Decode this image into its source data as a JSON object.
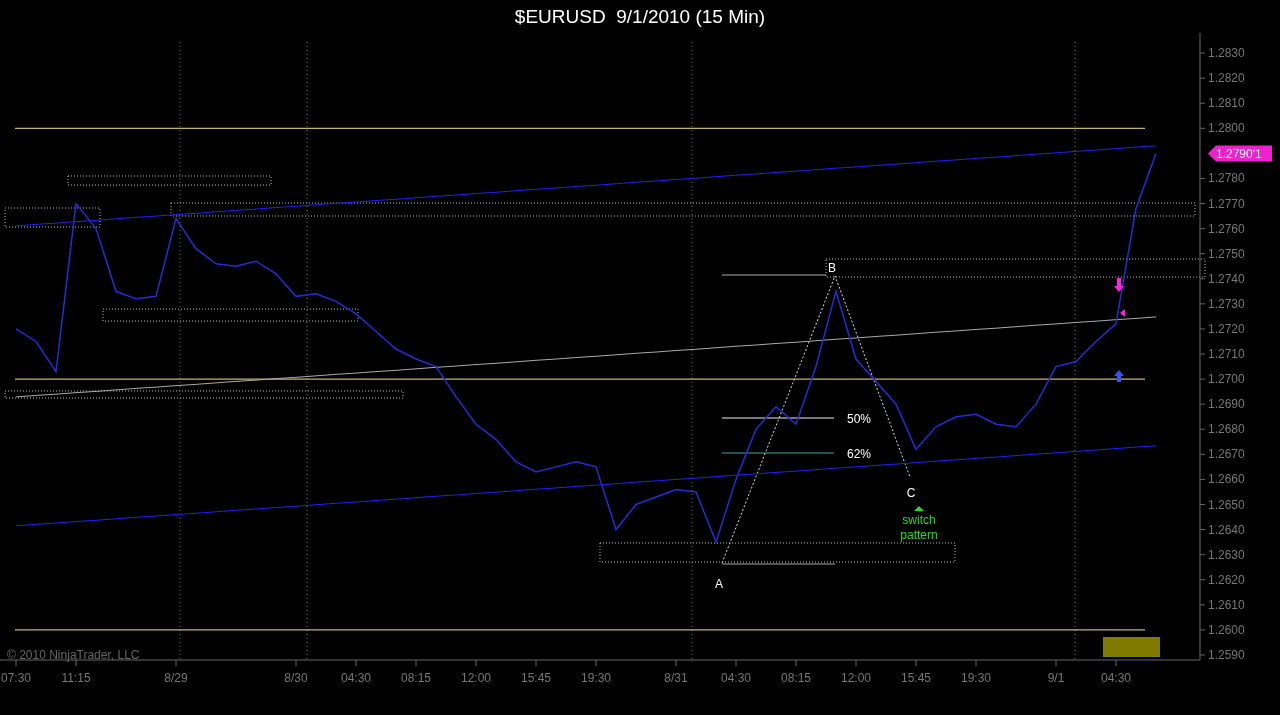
{
  "window": {
    "title": "$EURUSD  9/1/2010 (15 Min)"
  },
  "chart": {
    "copyright": "© 2010 NinjaTrader, LLC",
    "price_marker": {
      "label": "1.2790'1"
    },
    "chart_data": {
      "type": "line",
      "categories": [
        "07:30",
        null,
        null,
        "11:15",
        null,
        null,
        null,
        null,
        "8/29",
        null,
        null,
        null,
        null,
        null,
        "8/30",
        null,
        null,
        "04:30",
        null,
        null,
        "08:15",
        null,
        null,
        "12:00",
        null,
        null,
        "15:45",
        null,
        null,
        "19:30",
        null,
        null,
        null,
        "8/31",
        null,
        null,
        "04:30",
        null,
        null,
        "08:15",
        null,
        null,
        "12:00",
        null,
        null,
        "15:45",
        null,
        null,
        "19:30",
        null,
        null,
        null,
        "9/1",
        null,
        null,
        "04:30",
        null,
        null
      ],
      "series": [
        {
          "color": "#2a2ad8",
          "values": [
            1.272,
            1.2715,
            1.2703,
            1.277,
            1.276,
            1.2735,
            1.2732,
            1.2733,
            1.2764,
            1.2752,
            1.2746,
            1.2745,
            1.2747,
            1.2742,
            1.2733,
            1.2734,
            1.2731,
            1.2726,
            1.2719,
            1.2712,
            1.2708,
            1.2705,
            1.2693,
            1.2682,
            1.2676,
            1.2667,
            1.2663,
            1.2665,
            1.2667,
            1.2665,
            1.264,
            1.265,
            1.2653,
            1.2656,
            1.2655,
            1.2635,
            1.266,
            1.268,
            1.2689,
            1.2682,
            1.2705,
            1.2735,
            1.2708,
            1.2699,
            1.269,
            1.2672,
            1.2681,
            1.2685,
            1.2686,
            1.2682,
            1.2681,
            1.269,
            1.2705,
            1.2707,
            1.2715,
            1.2722,
            1.2768,
            1.279
          ]
        },
        {
          "color": "#2222ee",
          "values": [
            1.27611,
            1.27617,
            1.27622,
            1.27628,
            1.27633,
            1.27639,
            1.27645,
            1.2765,
            1.27656,
            1.27661,
            1.27667,
            1.27673,
            1.27678,
            1.27684,
            1.27689,
            1.27695,
            1.27701,
            1.27706,
            1.27712,
            1.27717,
            1.27723,
            1.27729,
            1.27734,
            1.2774,
            1.27745,
            1.27751,
            1.27757,
            1.27762,
            1.27768,
            1.27773,
            1.27779,
            1.27785,
            1.2779,
            1.27796,
            1.27801,
            1.27807,
            1.27813,
            1.27818,
            1.27824,
            1.27829,
            1.27835,
            1.27841,
            1.27846,
            1.27852,
            1.27857,
            1.27863,
            1.27869,
            1.27874,
            1.2788,
            1.27885,
            1.27891,
            1.27897,
            1.27902,
            1.27908,
            1.27913,
            1.27919,
            1.27925,
            1.2793
          ]
        },
        {
          "color": "#aaaaaa",
          "values": [
            1.26929,
            1.26935,
            1.2694,
            1.26946,
            1.26951,
            1.26957,
            1.26963,
            1.26968,
            1.26974,
            1.26979,
            1.26985,
            1.26991,
            1.26996,
            1.27002,
            1.27007,
            1.27013,
            1.27019,
            1.27024,
            1.2703,
            1.27035,
            1.27041,
            1.27047,
            1.27052,
            1.27058,
            1.27063,
            1.27069,
            1.27075,
            1.2708,
            1.27086,
            1.27091,
            1.27097,
            1.27103,
            1.27108,
            1.27114,
            1.27119,
            1.27125,
            1.27131,
            1.27136,
            1.27142,
            1.27147,
            1.27153,
            1.27159,
            1.27164,
            1.2717,
            1.27175,
            1.27181,
            1.27187,
            1.27192,
            1.27198,
            1.27203,
            1.27209,
            1.27215,
            1.2722,
            1.27226,
            1.27231,
            1.27237,
            1.27242,
            1.27248
          ]
        },
        {
          "color": "#2222ee",
          "values": [
            1.26415,
            1.26421,
            1.26426,
            1.26432,
            1.26437,
            1.26443,
            1.26449,
            1.26454,
            1.2646,
            1.26465,
            1.26471,
            1.26477,
            1.26482,
            1.26488,
            1.26493,
            1.26499,
            1.26505,
            1.2651,
            1.26516,
            1.26521,
            1.26527,
            1.26533,
            1.26538,
            1.26544,
            1.26549,
            1.26555,
            1.26561,
            1.26566,
            1.26572,
            1.26577,
            1.26583,
            1.26589,
            1.26594,
            1.266,
            1.26605,
            1.26611,
            1.26617,
            1.26622,
            1.26628,
            1.26633,
            1.26639,
            1.26645,
            1.2665,
            1.26656,
            1.26661,
            1.26667,
            1.26673,
            1.26678,
            1.26684,
            1.26689,
            1.26695,
            1.26701,
            1.26706,
            1.26712,
            1.26717,
            1.26723,
            1.26729,
            1.26734
          ]
        }
      ],
      "grid": true,
      "ylim": [
        1.2588,
        1.2838
      ],
      "yticks": [
        {
          "value": 1.259,
          "label": "1.2590"
        },
        {
          "value": 1.26,
          "label": "1.2600"
        },
        {
          "value": 1.261,
          "label": "1.2610"
        },
        {
          "value": 1.262,
          "label": "1.2620"
        },
        {
          "value": 1.263,
          "label": "1.2630"
        },
        {
          "value": 1.264,
          "label": "1.2640"
        },
        {
          "value": 1.265,
          "label": "1.2650"
        },
        {
          "value": 1.266,
          "label": "1.2660"
        },
        {
          "value": 1.267,
          "label": "1.2670"
        },
        {
          "value": 1.268,
          "label": "1.2680"
        },
        {
          "value": 1.269,
          "label": "1.2690"
        },
        {
          "value": 1.27,
          "label": "1.2700"
        },
        {
          "value": 1.271,
          "label": "1.2710"
        },
        {
          "value": 1.272,
          "label": "1.2720"
        },
        {
          "value": 1.273,
          "label": "1.2730"
        },
        {
          "value": 1.274,
          "label": "1.2740"
        },
        {
          "value": 1.275,
          "label": "1.2750"
        },
        {
          "value": 1.276,
          "label": "1.2760"
        },
        {
          "value": 1.277,
          "label": "1.2770"
        },
        {
          "value": 1.278,
          "label": "1.2780"
        },
        {
          "value": 1.28,
          "label": "1.2800"
        },
        {
          "value": 1.281,
          "label": "1.2810"
        },
        {
          "value": 1.282,
          "label": "1.2820"
        },
        {
          "value": 1.283,
          "label": "1.2830"
        }
      ]
    },
    "labels": [
      {
        "kind": "point",
        "text": "B"
      },
      {
        "kind": "fib",
        "text": "50%"
      },
      {
        "kind": "fib",
        "text": "62%"
      },
      {
        "kind": "point",
        "text": "C"
      },
      {
        "kind": "signal",
        "text": "switch"
      },
      {
        "kind": "signal",
        "text": "pattern"
      },
      {
        "kind": "point",
        "text": "A"
      }
    ]
  }
}
